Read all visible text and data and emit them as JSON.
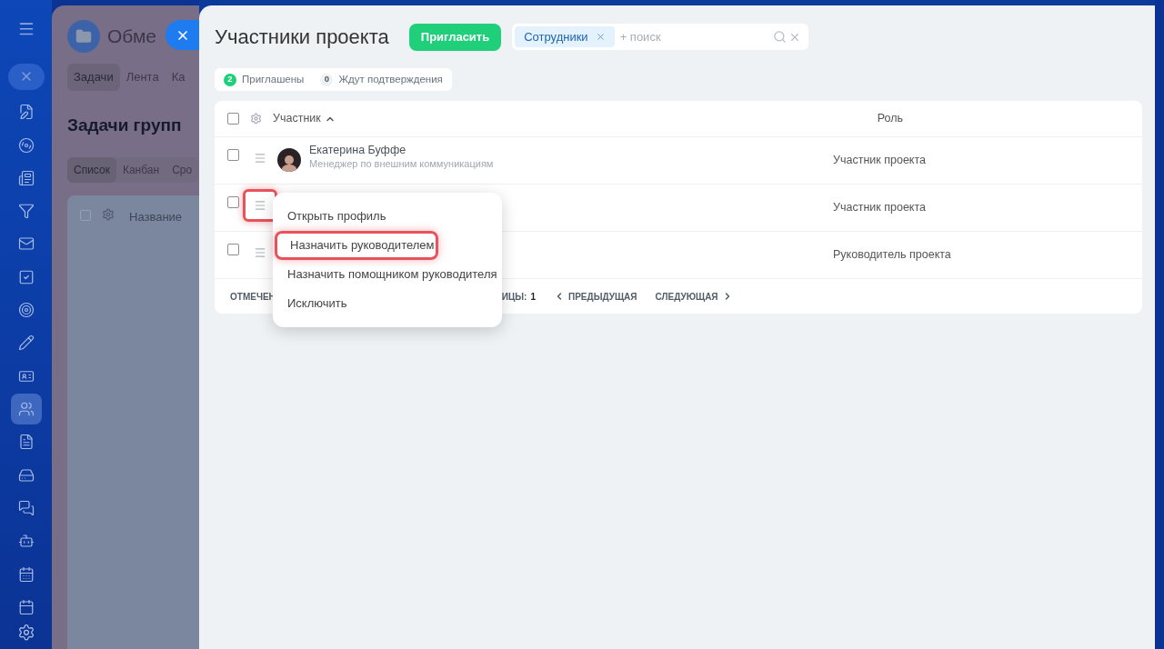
{
  "sidebar": {
    "items": [
      {
        "selected": false
      },
      {
        "selected": false
      },
      {
        "selected": false
      },
      {
        "selected": false
      },
      {
        "selected": false
      },
      {
        "selected": false
      },
      {
        "selected": false
      },
      {
        "selected": false
      },
      {
        "selected": false
      },
      {
        "selected": true
      },
      {
        "selected": false
      },
      {
        "selected": false
      },
      {
        "selected": false
      },
      {
        "selected": false
      },
      {
        "selected": false
      },
      {
        "selected": false
      }
    ]
  },
  "background_page": {
    "title": "Обме",
    "tabs": [
      {
        "label": "Задачи",
        "selected": true
      },
      {
        "label": "Лента",
        "selected": false
      },
      {
        "label": "Ка",
        "selected": false
      }
    ],
    "heading": "Задачи групп",
    "views": [
      {
        "label": "Список",
        "selected": true
      },
      {
        "label": "Канбан",
        "selected": false
      },
      {
        "label": "Сро",
        "selected": false
      }
    ],
    "table_checked": false,
    "table_column": "Название"
  },
  "panel": {
    "title": "Участники проекта",
    "invite_button": "Пригласить",
    "search": {
      "tag": "Сотрудники",
      "placeholder": "+ поиск"
    },
    "counters": [
      {
        "count": "2",
        "label": "Приглашены",
        "active": true
      },
      {
        "count": "0",
        "label": "Ждут подтверждения",
        "active": false
      }
    ],
    "table": {
      "all_checked": false,
      "columns": [
        "Участник",
        "Роль"
      ],
      "rows": [
        {
          "checked": false,
          "name": "Екатерина Буффе",
          "position": "Менеджер по внешним коммуникациям",
          "role": "Участник проекта",
          "menu_highlighted": false
        },
        {
          "checked": false,
          "role": "Участник проекта",
          "menu_highlighted": true
        },
        {
          "checked": false,
          "role": "Руководитель проекта",
          "menu_highlighted": false
        }
      ],
      "footer": {
        "selected_label": "ОТМЕЧЕН",
        "page_label": "ИЦЫ:",
        "page": "1",
        "prev": "ПРЕДЫДУЩАЯ",
        "next": "СЛЕДУЮЩАЯ"
      }
    },
    "menu": {
      "items": [
        {
          "label": "Открыть профиль",
          "highlighted": false
        },
        {
          "label": "Назначить руководителем",
          "highlighted": true
        },
        {
          "label": "Назначить помощником руководителя",
          "highlighted": false
        },
        {
          "label": "Исключить",
          "highlighted": false
        }
      ]
    }
  }
}
